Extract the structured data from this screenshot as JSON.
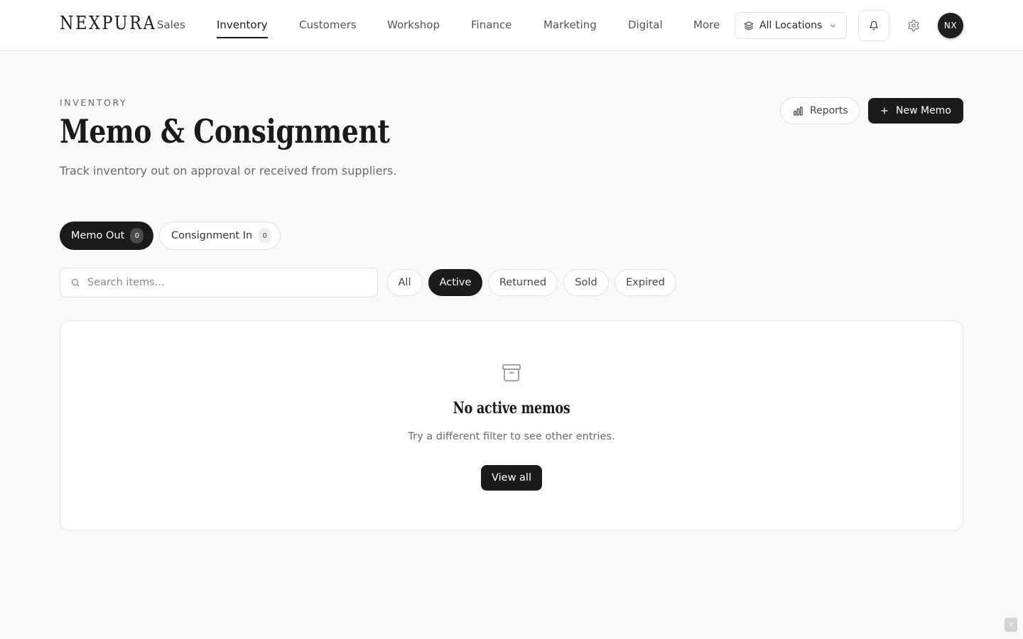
{
  "brand": {
    "logo": "NEXPURA"
  },
  "nav": {
    "items": [
      {
        "label": "Sales",
        "active": false
      },
      {
        "label": "Inventory",
        "active": true
      },
      {
        "label": "Customers",
        "active": false
      },
      {
        "label": "Workshop",
        "active": false
      },
      {
        "label": "Finance",
        "active": false
      },
      {
        "label": "Marketing",
        "active": false
      },
      {
        "label": "Digital",
        "active": false
      },
      {
        "label": "More",
        "active": false
      }
    ],
    "location_label": "All Locations",
    "avatar_initials": "NX"
  },
  "header": {
    "eyebrow": "INVENTORY",
    "title": "Memo & Consignment",
    "subtitle": "Track inventory out on approval or received from suppliers.",
    "reports_label": "Reports",
    "new_memo_label": "New Memo"
  },
  "segments": {
    "memo_out": {
      "label": "Memo Out",
      "count": "0"
    },
    "consignment_in": {
      "label": "Consignment In",
      "count": "0"
    }
  },
  "search": {
    "placeholder": "Search items..."
  },
  "filters": [
    {
      "label": "All",
      "active": false
    },
    {
      "label": "Active",
      "active": true
    },
    {
      "label": "Returned",
      "active": false
    },
    {
      "label": "Sold",
      "active": false
    },
    {
      "label": "Expired",
      "active": false
    }
  ],
  "empty_state": {
    "title": "No active memos",
    "subtitle": "Try a different filter to see other entries.",
    "button_label": "View all"
  },
  "corner_badge": "v",
  "colors": {
    "background": "#f9f9f8",
    "surface": "#ffffff",
    "primary": "#1b1b1b",
    "border": "#e3e2df",
    "muted_text": "#6a6a6a"
  },
  "icons": {
    "location": "layers-icon",
    "location_chevron": "chevron-down-icon",
    "notifications": "bell-icon",
    "settings": "gear-icon",
    "reports": "bar-chart-icon",
    "new_memo": "plus-icon",
    "search": "search-icon",
    "empty_state": "archive-icon"
  }
}
